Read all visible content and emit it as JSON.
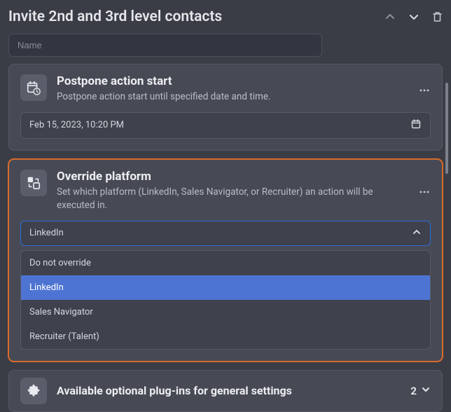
{
  "header": {
    "title": "Invite 2nd and 3rd level contacts"
  },
  "name_input": {
    "placeholder": "Name",
    "value": ""
  },
  "postpone_card": {
    "title": "Postpone action start",
    "description": "Postpone action start until specified date and time.",
    "value": "Feb 15, 2023, 10:20 PM"
  },
  "override_card": {
    "title": "Override platform",
    "description": "Set which platform (LinkedIn, Sales Navigator, or Recruiter) an action will be executed in.",
    "selected": "LinkedIn",
    "options": {
      "o0": "Do not override",
      "o1": "LinkedIn",
      "o2": "Sales Navigator",
      "o3": "Recruiter (Talent)"
    },
    "highlight_color": "#d96b2b"
  },
  "plugins_card": {
    "title": "Available optional plug-ins for general settings",
    "count": "2"
  }
}
